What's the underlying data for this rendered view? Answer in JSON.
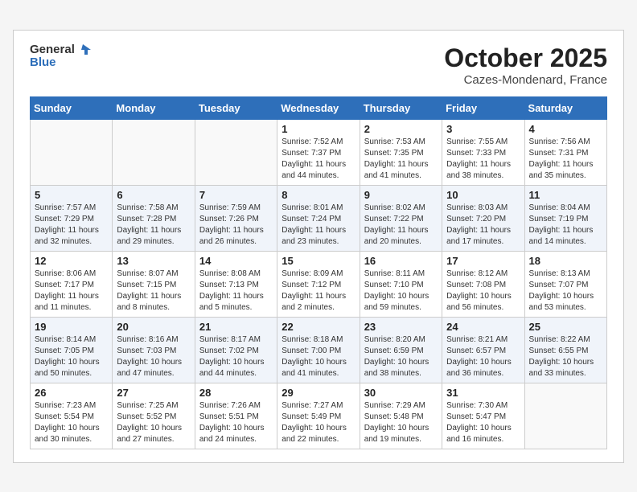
{
  "header": {
    "logo_line1": "General",
    "logo_line2": "Blue",
    "month": "October 2025",
    "location": "Cazes-Mondenard, France"
  },
  "weekdays": [
    "Sunday",
    "Monday",
    "Tuesday",
    "Wednesday",
    "Thursday",
    "Friday",
    "Saturday"
  ],
  "weeks": [
    [
      {
        "day": "",
        "info": ""
      },
      {
        "day": "",
        "info": ""
      },
      {
        "day": "",
        "info": ""
      },
      {
        "day": "1",
        "info": "Sunrise: 7:52 AM\nSunset: 7:37 PM\nDaylight: 11 hours\nand 44 minutes."
      },
      {
        "day": "2",
        "info": "Sunrise: 7:53 AM\nSunset: 7:35 PM\nDaylight: 11 hours\nand 41 minutes."
      },
      {
        "day": "3",
        "info": "Sunrise: 7:55 AM\nSunset: 7:33 PM\nDaylight: 11 hours\nand 38 minutes."
      },
      {
        "day": "4",
        "info": "Sunrise: 7:56 AM\nSunset: 7:31 PM\nDaylight: 11 hours\nand 35 minutes."
      }
    ],
    [
      {
        "day": "5",
        "info": "Sunrise: 7:57 AM\nSunset: 7:29 PM\nDaylight: 11 hours\nand 32 minutes."
      },
      {
        "day": "6",
        "info": "Sunrise: 7:58 AM\nSunset: 7:28 PM\nDaylight: 11 hours\nand 29 minutes."
      },
      {
        "day": "7",
        "info": "Sunrise: 7:59 AM\nSunset: 7:26 PM\nDaylight: 11 hours\nand 26 minutes."
      },
      {
        "day": "8",
        "info": "Sunrise: 8:01 AM\nSunset: 7:24 PM\nDaylight: 11 hours\nand 23 minutes."
      },
      {
        "day": "9",
        "info": "Sunrise: 8:02 AM\nSunset: 7:22 PM\nDaylight: 11 hours\nand 20 minutes."
      },
      {
        "day": "10",
        "info": "Sunrise: 8:03 AM\nSunset: 7:20 PM\nDaylight: 11 hours\nand 17 minutes."
      },
      {
        "day": "11",
        "info": "Sunrise: 8:04 AM\nSunset: 7:19 PM\nDaylight: 11 hours\nand 14 minutes."
      }
    ],
    [
      {
        "day": "12",
        "info": "Sunrise: 8:06 AM\nSunset: 7:17 PM\nDaylight: 11 hours\nand 11 minutes."
      },
      {
        "day": "13",
        "info": "Sunrise: 8:07 AM\nSunset: 7:15 PM\nDaylight: 11 hours\nand 8 minutes."
      },
      {
        "day": "14",
        "info": "Sunrise: 8:08 AM\nSunset: 7:13 PM\nDaylight: 11 hours\nand 5 minutes."
      },
      {
        "day": "15",
        "info": "Sunrise: 8:09 AM\nSunset: 7:12 PM\nDaylight: 11 hours\nand 2 minutes."
      },
      {
        "day": "16",
        "info": "Sunrise: 8:11 AM\nSunset: 7:10 PM\nDaylight: 10 hours\nand 59 minutes."
      },
      {
        "day": "17",
        "info": "Sunrise: 8:12 AM\nSunset: 7:08 PM\nDaylight: 10 hours\nand 56 minutes."
      },
      {
        "day": "18",
        "info": "Sunrise: 8:13 AM\nSunset: 7:07 PM\nDaylight: 10 hours\nand 53 minutes."
      }
    ],
    [
      {
        "day": "19",
        "info": "Sunrise: 8:14 AM\nSunset: 7:05 PM\nDaylight: 10 hours\nand 50 minutes."
      },
      {
        "day": "20",
        "info": "Sunrise: 8:16 AM\nSunset: 7:03 PM\nDaylight: 10 hours\nand 47 minutes."
      },
      {
        "day": "21",
        "info": "Sunrise: 8:17 AM\nSunset: 7:02 PM\nDaylight: 10 hours\nand 44 minutes."
      },
      {
        "day": "22",
        "info": "Sunrise: 8:18 AM\nSunset: 7:00 PM\nDaylight: 10 hours\nand 41 minutes."
      },
      {
        "day": "23",
        "info": "Sunrise: 8:20 AM\nSunset: 6:59 PM\nDaylight: 10 hours\nand 38 minutes."
      },
      {
        "day": "24",
        "info": "Sunrise: 8:21 AM\nSunset: 6:57 PM\nDaylight: 10 hours\nand 36 minutes."
      },
      {
        "day": "25",
        "info": "Sunrise: 8:22 AM\nSunset: 6:55 PM\nDaylight: 10 hours\nand 33 minutes."
      }
    ],
    [
      {
        "day": "26",
        "info": "Sunrise: 7:23 AM\nSunset: 5:54 PM\nDaylight: 10 hours\nand 30 minutes."
      },
      {
        "day": "27",
        "info": "Sunrise: 7:25 AM\nSunset: 5:52 PM\nDaylight: 10 hours\nand 27 minutes."
      },
      {
        "day": "28",
        "info": "Sunrise: 7:26 AM\nSunset: 5:51 PM\nDaylight: 10 hours\nand 24 minutes."
      },
      {
        "day": "29",
        "info": "Sunrise: 7:27 AM\nSunset: 5:49 PM\nDaylight: 10 hours\nand 22 minutes."
      },
      {
        "day": "30",
        "info": "Sunrise: 7:29 AM\nSunset: 5:48 PM\nDaylight: 10 hours\nand 19 minutes."
      },
      {
        "day": "31",
        "info": "Sunrise: 7:30 AM\nSunset: 5:47 PM\nDaylight: 10 hours\nand 16 minutes."
      },
      {
        "day": "",
        "info": ""
      }
    ]
  ]
}
